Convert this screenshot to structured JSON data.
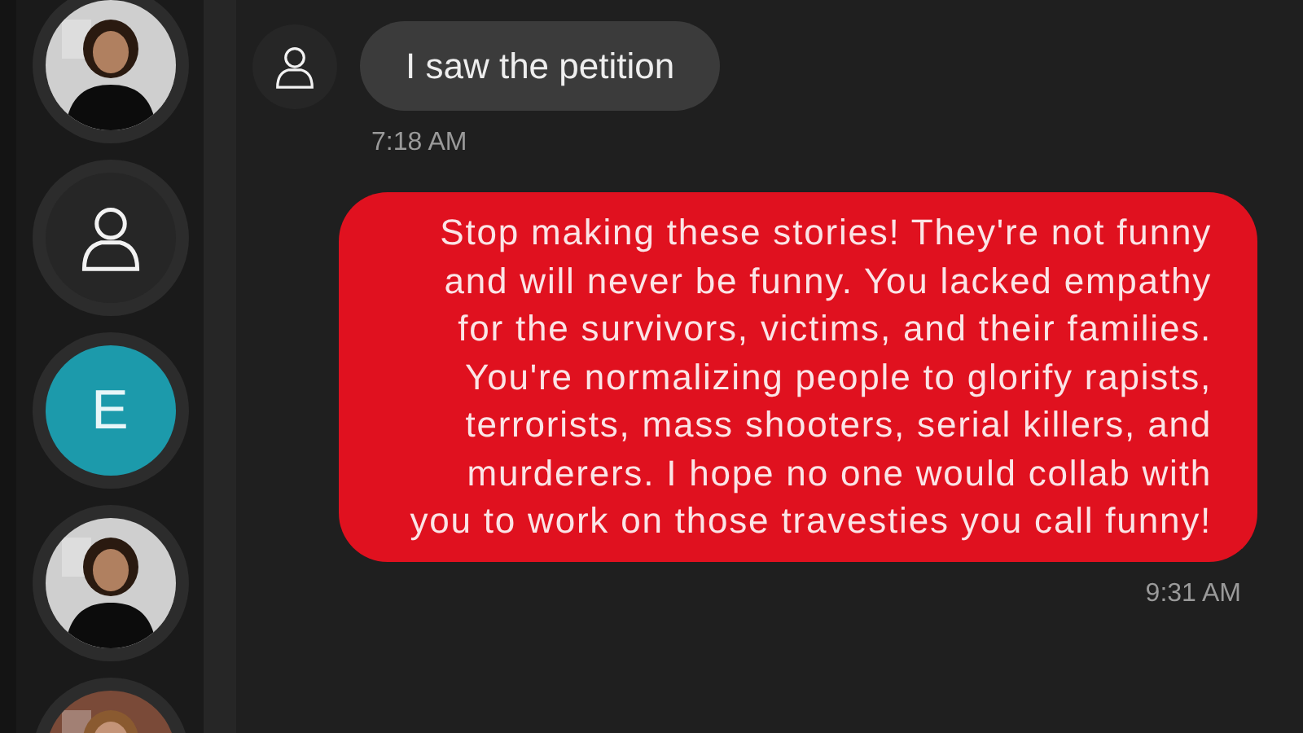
{
  "contacts": [
    {
      "kind": "picture"
    },
    {
      "kind": "placeholder"
    },
    {
      "kind": "letter",
      "letter": "E",
      "color": "#1c9aab"
    },
    {
      "kind": "picture"
    },
    {
      "kind": "picture"
    }
  ],
  "messages": [
    {
      "kind": "incoming",
      "text": "I saw the petition",
      "time": "7:18 AM"
    },
    {
      "kind": "outgoing",
      "text": "Stop making these stories! They're not funny and will never be funny. You lacked empathy for the survivors, victims, and their families. You're normalizing people to glorify rapists, terrorists, mass shooters, serial killers, and murderers. I hope no one would collab with you to work on those travesties you call funny!",
      "time": "9:31 AM"
    }
  ]
}
